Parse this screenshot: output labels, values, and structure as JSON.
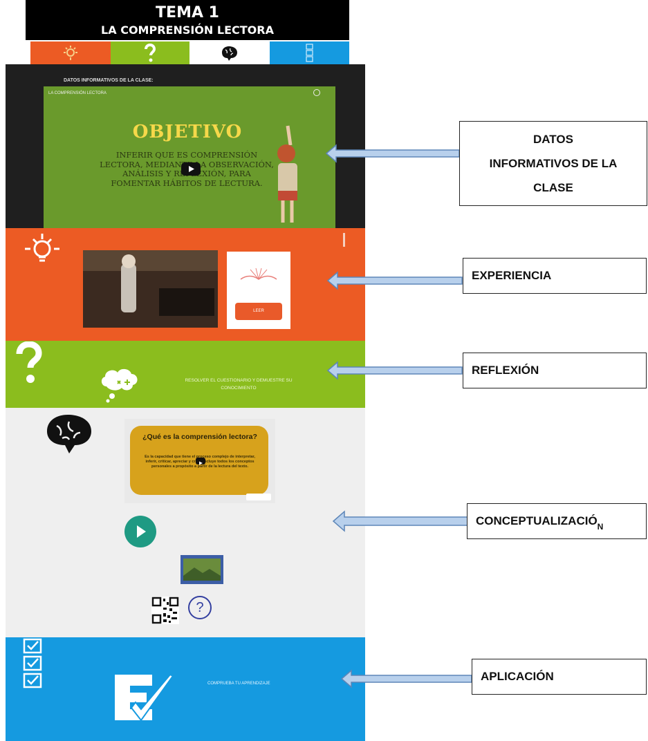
{
  "header": {
    "title": "TEMA 1",
    "subtitle": "LA COMPRENSIÓN LECTORA"
  },
  "nav": [
    {
      "icon": "lightbulb-icon",
      "color": "#ec5b24"
    },
    {
      "icon": "question-mark-icon",
      "color": "#8bbd1e"
    },
    {
      "icon": "brain-icon",
      "color": "#ffffff"
    },
    {
      "icon": "checklist-icon",
      "color": "#159ae0"
    }
  ],
  "datos": {
    "label": "DATOS INFORMATIVOS DE LA CLASE:",
    "video_title": "LA COMPRENSIÓN LECTORA",
    "heading": "OBJETIVO",
    "text": "INFERIR QUE ES COMPRENSIÓN LECTORA, MEDIANTE LA OBSERVACIÓN, ANÁLISIS Y REFLEXIÓN, PARA FOMENTAR HÁBITOS DE LECTURA."
  },
  "experiencia": {
    "button": "LEER"
  },
  "reflexion": {
    "text": "RESOLVER EL CUESTIONARIO Y DEMUESTRE SU CONOCIMIENTO"
  },
  "conceptualizacion": {
    "video_title": "¿Qué es la comprensión lectora?",
    "video_text": "Es la capacidad que tiene el proceso complejo de interpretar, inferir, criticar, apreciar y crear, incluye todos los conceptos personales a propósito a partir de la lectura del texto."
  },
  "aplicacion": {
    "text": "COMPRUEBA TU APRENDIZAJE"
  },
  "annotations": {
    "datos": [
      "DATOS",
      "INFORMATIVOS DE LA",
      "CLASE"
    ],
    "experiencia": "EXPERIENCIA",
    "reflexion": "REFLEXIÓN",
    "conceptualizacion": "CONCEPTUALIZACIÓ",
    "conceptualizacion_sub": "N",
    "aplicacion": "APLICACIÓN"
  },
  "colors": {
    "arrow": "#b8d0ec",
    "arrow_border": "#5d86b8"
  }
}
